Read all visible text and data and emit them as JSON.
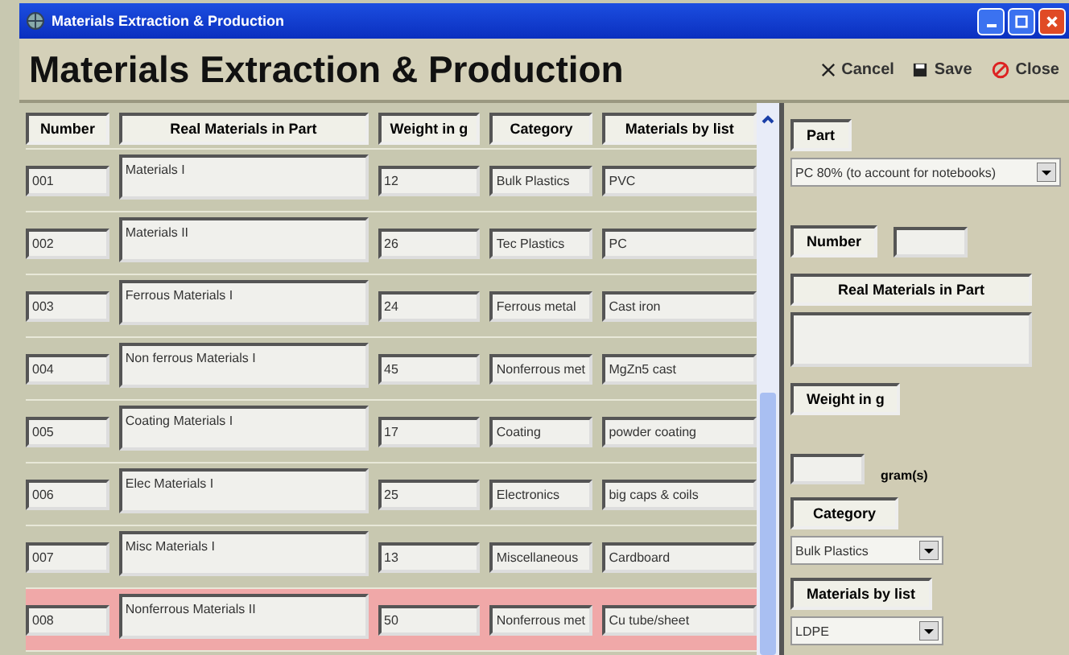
{
  "window": {
    "title": "Materials Extraction & Production"
  },
  "header": {
    "title": "Materials Extraction & Production",
    "actions": [
      {
        "kind": "cancel",
        "label": "Cancel"
      },
      {
        "kind": "save",
        "label": "Save"
      },
      {
        "kind": "close",
        "label": "Close"
      }
    ]
  },
  "table": {
    "columns": [
      "Number",
      "Real Materials in Part",
      "Weight in g",
      "Category",
      "Materials by list"
    ],
    "rows": [
      {
        "number": "001",
        "material": "Materials I",
        "weight": "12",
        "category": "Bulk Plastics",
        "list": "PVC",
        "selected": false
      },
      {
        "number": "002",
        "material": "Materials II",
        "weight": "26",
        "category": "Tec Plastics",
        "list": "PC",
        "selected": false
      },
      {
        "number": "003",
        "material": "Ferrous Materials I",
        "weight": "24",
        "category": "Ferrous metal",
        "list": "Cast iron",
        "selected": false
      },
      {
        "number": "004",
        "material": "Non ferrous Materials I",
        "weight": "45",
        "category": "Nonferrous met",
        "list": "MgZn5 cast",
        "selected": false
      },
      {
        "number": "005",
        "material": "Coating Materials I",
        "weight": "17",
        "category": "Coating",
        "list": "powder coating",
        "selected": false
      },
      {
        "number": "006",
        "material": "Elec Materials I",
        "weight": "25",
        "category": "Electronics",
        "list": "big caps & coils",
        "selected": false
      },
      {
        "number": "007",
        "material": "Misc Materials I",
        "weight": "13",
        "category": "Miscellaneous",
        "list": "Cardboard",
        "selected": false
      },
      {
        "number": "008",
        "material": "Nonferrous Materials II",
        "weight": "50",
        "category": "Nonferrous met",
        "list": "Cu tube/sheet",
        "selected": true
      }
    ]
  },
  "form": {
    "part_label": "Part",
    "part_value": "PC 80% (to account for notebooks)",
    "number_label": "Number",
    "material_label": "Real Materials in Part",
    "weight_label": "Weight in g",
    "weight_unit": "gram(s)",
    "category_label": "Category",
    "category_value": "Bulk Plastics",
    "list_label": "Materials by list",
    "list_value": "LDPE"
  }
}
